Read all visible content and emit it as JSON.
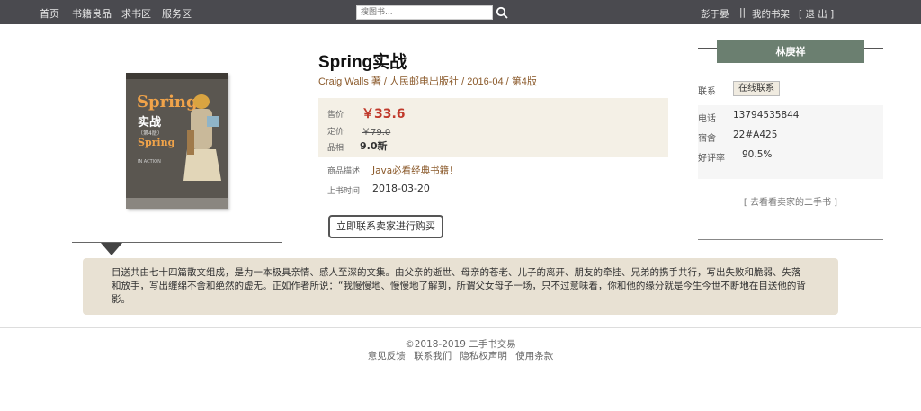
{
  "nav": {
    "links": [
      "首页",
      "书籍良品",
      "求书区",
      "服务区"
    ],
    "search_placeholder": "搜图书...",
    "user": "彭于晏",
    "separator": "||",
    "my_shelf": "我的书架",
    "logout": "[ 退 出 ]"
  },
  "book": {
    "cover": {
      "title_en": "Spring",
      "title_cn": "实战",
      "edition_tag": "（第4版）",
      "subtitle_en": "Spring",
      "subtitle_en2": "IN ACTION"
    },
    "title": "Spring实战",
    "meta": "Craig Walls 著 / 人民邮电出版社 / 2016-04 / 第4版",
    "price_label": "售价",
    "price": "￥33.6",
    "orig_label": "定价",
    "orig_price": "￥79.0",
    "cond_label": "品相",
    "condition": "9.0新",
    "desc_label": "商品描述",
    "desc": "Java必看经典书籍！",
    "time_label": "上书时间",
    "time": "2018-03-20",
    "buy_button": "立即联系卖家进行购买"
  },
  "seller": {
    "name": "林庚祥",
    "contact_label": "联系",
    "contact_button": "在线联系",
    "phone_label": "电话",
    "phone": "13794535844",
    "dorm_label": "宿舍",
    "dorm": "22#A425",
    "rating_label": "好评率",
    "rating": "90.5%",
    "see_more": "[ 去看看卖家的二手书 ]"
  },
  "summary": "目送共由七十四篇散文组成，是为一本极具亲情、感人至深的文集。由父亲的逝世、母亲的苍老、儿子的离开、朋友的牵挂、兄弟的携手共行，写出失败和脆弱、失落和放手，写出缠绵不舍和绝然的虚无。正如作者所说：“我慢慢地、慢慢地了解到，所谓父女母子一场，只不过意味着，你和他的缘分就是今生今世不断地在目送他的背影。",
  "footer": {
    "copyright": "©2018-2019 二手书交易",
    "links": [
      "意见反馈",
      "联系我们",
      "隐私权声明",
      "使用条款"
    ]
  },
  "colors": {
    "nav_bg": "#4a4a4f",
    "price_red": "#c0392b",
    "meta_brown": "#8b5a2b",
    "seller_green": "#6b7f70",
    "summary_bg": "#e8e1d3"
  }
}
